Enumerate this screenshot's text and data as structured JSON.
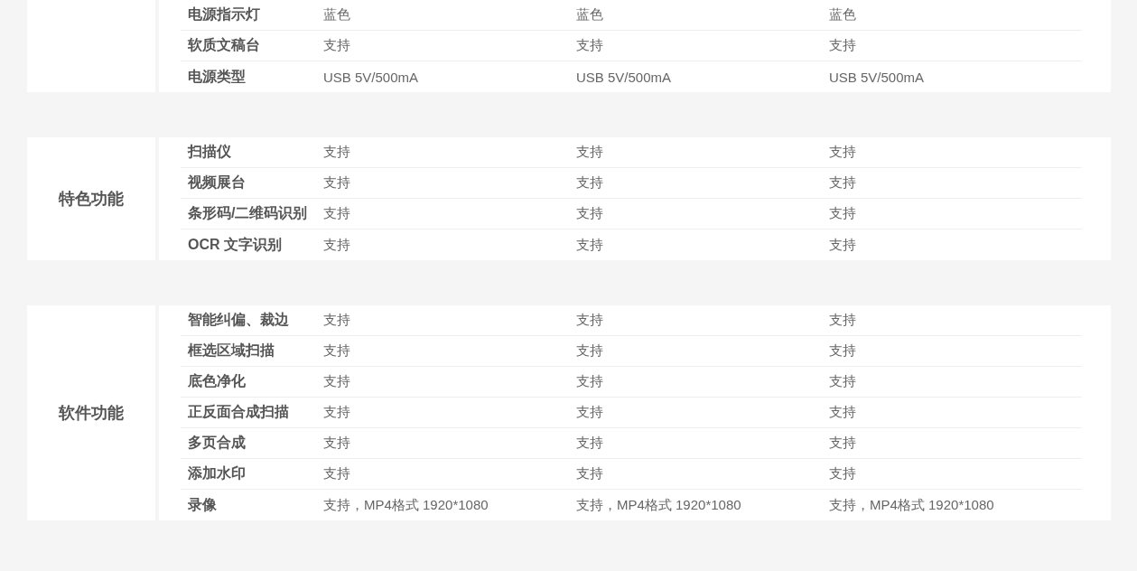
{
  "sections": [
    {
      "rows": [
        {
          "label": "电源指示灯",
          "values": [
            "蓝色",
            "蓝色",
            "蓝色"
          ]
        },
        {
          "label": "软质文稿台",
          "values": [
            "支持",
            "支持",
            "支持"
          ]
        },
        {
          "label": "电源类型",
          "values": [
            "USB 5V/500mA",
            "USB 5V/500mA",
            "USB 5V/500mA"
          ]
        }
      ]
    },
    {
      "title": "特色功能",
      "rows": [
        {
          "label": "扫描仪",
          "values": [
            "支持",
            "支持",
            "支持"
          ]
        },
        {
          "label": "视频展台",
          "values": [
            "支持",
            "支持",
            "支持"
          ]
        },
        {
          "label": "条形码/二维码识别",
          "values": [
            "支持",
            "支持",
            "支持"
          ]
        },
        {
          "label": "OCR 文字识别",
          "values": [
            "支持",
            "支持",
            "支持"
          ]
        }
      ]
    },
    {
      "title": "软件功能",
      "rows": [
        {
          "label": "智能纠偏、裁边",
          "values": [
            "支持",
            "支持",
            "支持"
          ]
        },
        {
          "label": "框选区域扫描",
          "values": [
            "支持",
            "支持",
            "支持"
          ]
        },
        {
          "label": "底色净化",
          "values": [
            "支持",
            "支持",
            "支持"
          ]
        },
        {
          "label": "正反面合成扫描",
          "values": [
            "支持",
            "支持",
            "支持"
          ]
        },
        {
          "label": "多页合成",
          "values": [
            "支持",
            "支持",
            "支持"
          ]
        },
        {
          "label": "添加水印",
          "values": [
            "支持",
            "支持",
            "支持"
          ]
        },
        {
          "label": "录像",
          "values": [
            "支持，MP4格式 1920*1080",
            "支持，MP4格式 1920*1080",
            "支持，MP4格式 1920*1080"
          ]
        }
      ]
    }
  ]
}
